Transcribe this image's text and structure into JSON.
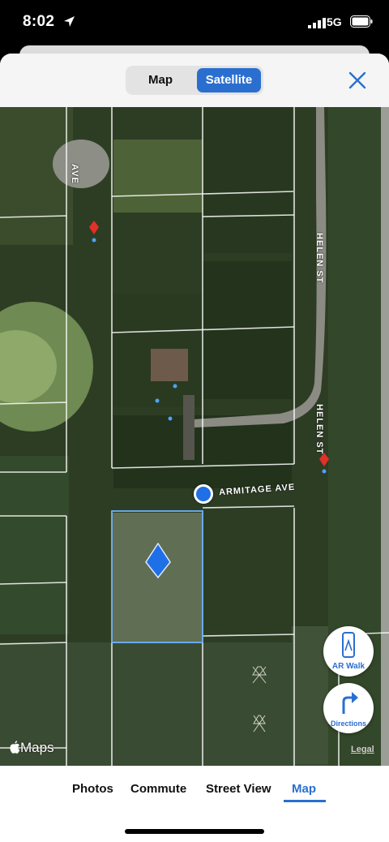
{
  "status": {
    "time": "8:02",
    "network": "5G"
  },
  "header": {
    "segments": [
      {
        "label": "Map",
        "selected": false
      },
      {
        "label": "Satellite",
        "selected": true
      }
    ],
    "accent": "#2a6fd0"
  },
  "map": {
    "streets": {
      "ave_top": "AVE",
      "helen_1": "HELEN ST",
      "helen_2": "HELEN ST",
      "armitage": "ARMITAGE AVE"
    },
    "brand": "Maps",
    "legal": "Legal"
  },
  "buttons": {
    "ar_walk": "AR Walk",
    "directions": "Directions"
  },
  "tabs": [
    {
      "label": "Photos"
    },
    {
      "label": "Commute"
    },
    {
      "label": "Street View"
    },
    {
      "label": "Map",
      "selected": true
    }
  ]
}
